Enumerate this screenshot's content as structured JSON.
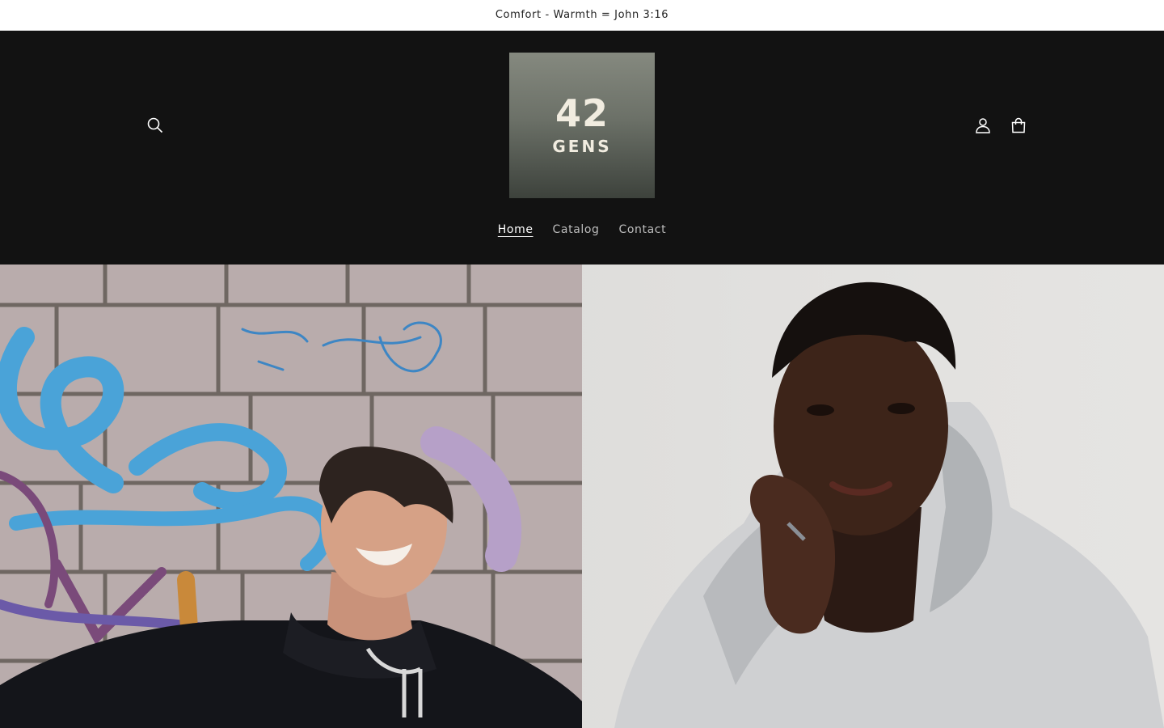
{
  "announcement": {
    "text": "Comfort - Warmth = John 3:16"
  },
  "header": {
    "logo": {
      "number": "42",
      "word": "GENS"
    },
    "icons": {
      "search": "search-icon",
      "account": "account-icon",
      "cart": "cart-icon"
    }
  },
  "nav": {
    "items": [
      {
        "label": "Home",
        "active": true
      },
      {
        "label": "Catalog",
        "active": false
      },
      {
        "label": "Contact",
        "active": false
      }
    ]
  },
  "hero": {
    "images": [
      {
        "name": "man-black-hoodie-graffiti-wall"
      },
      {
        "name": "man-grey-hoodie-portrait"
      }
    ]
  },
  "colors": {
    "header_bg": "#121212",
    "announcement_bg": "#ffffff",
    "logo_bg": "#6c7168"
  }
}
